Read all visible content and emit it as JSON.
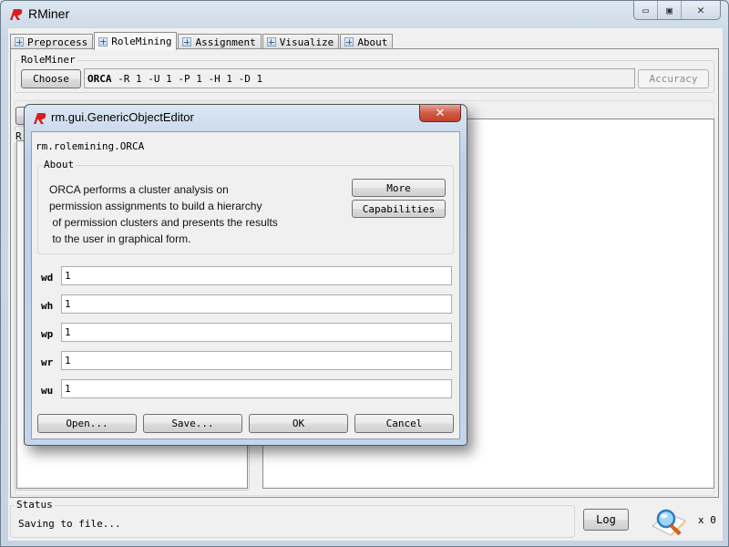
{
  "window": {
    "title": "RMiner",
    "controls": {
      "minimize_icon": "minimize-icon",
      "maximize_icon": "maximize-icon",
      "close_icon": "close-icon"
    }
  },
  "tabs": [
    {
      "label": "Preprocess",
      "active": false
    },
    {
      "label": "RoleMining",
      "active": true
    },
    {
      "label": "Assignment",
      "active": false
    },
    {
      "label": "Visualize",
      "active": false
    },
    {
      "label": "About",
      "active": false
    }
  ],
  "roleminer": {
    "group_title": "RoleMiner",
    "choose_label": "Choose",
    "algorithm_name": "ORCA",
    "algorithm_options": "-R 1 -U 1 -P 1 -H 1 -D 1",
    "accuracy_label": "Accuracy",
    "left_panel_initial": "R"
  },
  "dialog": {
    "title": "rm.gui.GenericObjectEditor",
    "class_name": "rm.rolemining.ORCA",
    "about": {
      "group_title": "About",
      "text": "ORCA performs a cluster analysis on\npermission assignments to build a hierarchy\n of permission clusters and presents the results\n to the user in graphical form.",
      "more_label": "More",
      "capabilities_label": "Capabilities"
    },
    "properties": [
      {
        "name": "wd",
        "value": "1"
      },
      {
        "name": "wh",
        "value": "1"
      },
      {
        "name": "wp",
        "value": "1"
      },
      {
        "name": "wr",
        "value": "1"
      },
      {
        "name": "wu",
        "value": "1"
      }
    ],
    "buttons": {
      "open": "Open...",
      "save": "Save...",
      "ok": "OK",
      "cancel": "Cancel"
    }
  },
  "status": {
    "group_title": "Status",
    "message": "Saving to file...",
    "log_label": "Log",
    "count": "x 0"
  }
}
